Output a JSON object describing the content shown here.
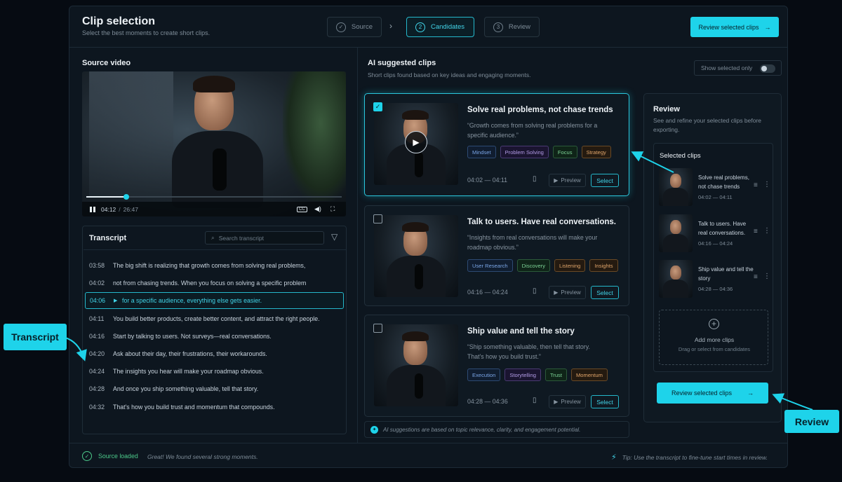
{
  "header": {
    "title": "Clip selection",
    "subtitle": "Select the best moments to create short clips.",
    "steps": [
      {
        "num": "✓",
        "label": "Source"
      },
      {
        "num": "2",
        "label": "Candidates"
      },
      {
        "num": "3",
        "label": "Review"
      }
    ],
    "cta": "Review selected clips"
  },
  "source": {
    "title": "Source video",
    "current_time": "04:12",
    "duration": "26:47",
    "progress_fraction": 0.157
  },
  "transcript": {
    "title": "Transcript",
    "search_placeholder": "Search transcript",
    "active_index": 2,
    "lines": [
      {
        "time": "03:58",
        "text": "The big shift is realizing that growth comes from solving real problems,"
      },
      {
        "time": "04:02",
        "text": "not from chasing trends. When you focus on solving a specific problem"
      },
      {
        "time": "04:06",
        "text": "for a specific audience, everything else gets easier."
      },
      {
        "time": "04:11",
        "text": "You build better products, create better content, and attract the right people."
      },
      {
        "time": "04:16",
        "text": "Start by talking to users. Not surveys—real conversations."
      },
      {
        "time": "04:20",
        "text": "Ask about their day, their frustrations, their workarounds."
      },
      {
        "time": "04:24",
        "text": "The insights you hear will make your roadmap obvious."
      },
      {
        "time": "04:28",
        "text": "And once you ship something valuable, tell that story."
      },
      {
        "time": "04:32",
        "text": "That's how you build trust and momentum that compounds."
      }
    ]
  },
  "ai": {
    "title": "AI suggested clips",
    "subtitle": "Short clips found based on key ideas and engaging moments.",
    "toggle_label": "Show selected only",
    "toggle_on": false,
    "preview_label": "Preview",
    "select_label": "Select",
    "note": "AI suggestions are based on topic relevance, clarity, and engagement potential.",
    "clips": [
      {
        "title": "Solve real problems, not chase trends",
        "quote": "“Growth comes from solving real problems for a specific audience.”",
        "range": "04:02 — 04:11",
        "selected": true,
        "tags": [
          {
            "label": "Mindset",
            "color": "blue"
          },
          {
            "label": "Problem Solving",
            "color": "purple"
          },
          {
            "label": "Focus",
            "color": "green"
          },
          {
            "label": "Strategy",
            "color": "orange"
          }
        ]
      },
      {
        "title": "Talk to users. Have real conversations.",
        "quote": "“Insights from real conversations will make your roadmap obvious.”",
        "range": "04:16 — 04:24",
        "selected": false,
        "tags": [
          {
            "label": "User Research",
            "color": "blue"
          },
          {
            "label": "Discovery",
            "color": "green"
          },
          {
            "label": "Listening",
            "color": "orange"
          },
          {
            "label": "Insights",
            "color": "orange"
          }
        ]
      },
      {
        "title": "Ship value and tell the story",
        "quote": "“Ship something valuable, then tell that story. That's how you build trust.”",
        "range": "04:28 — 04:36",
        "selected": false,
        "tags": [
          {
            "label": "Execution",
            "color": "blue"
          },
          {
            "label": "Storytelling",
            "color": "purple"
          },
          {
            "label": "Trust",
            "color": "green"
          },
          {
            "label": "Momentum",
            "color": "orange"
          }
        ]
      }
    ]
  },
  "review": {
    "title": "Review",
    "subtitle": "See and refine your selected clips before exporting.",
    "selected_title": "Selected clips",
    "items": [
      {
        "name": "Solve real problems, not chase trends",
        "range": "04:02 — 04:11"
      },
      {
        "name": "Talk to users. Have real conversations.",
        "range": "04:16 — 04:24"
      },
      {
        "name": "Ship value and tell the story",
        "range": "04:28 — 04:36"
      }
    ],
    "add_title": "Add more clips",
    "add_sub": "Drag or select from candidates",
    "cta": "Review selected clips"
  },
  "footer": {
    "status": "Source loaded",
    "message": "Great! We found several strong moments.",
    "tip": "Tip: Use the transcript to fine-tune start times in review."
  },
  "callouts": {
    "transcript": "Transcript",
    "review": "Review"
  },
  "colors": {
    "accent": "#1ed3ea",
    "background": "#0d161f",
    "success": "#4cc98a"
  }
}
